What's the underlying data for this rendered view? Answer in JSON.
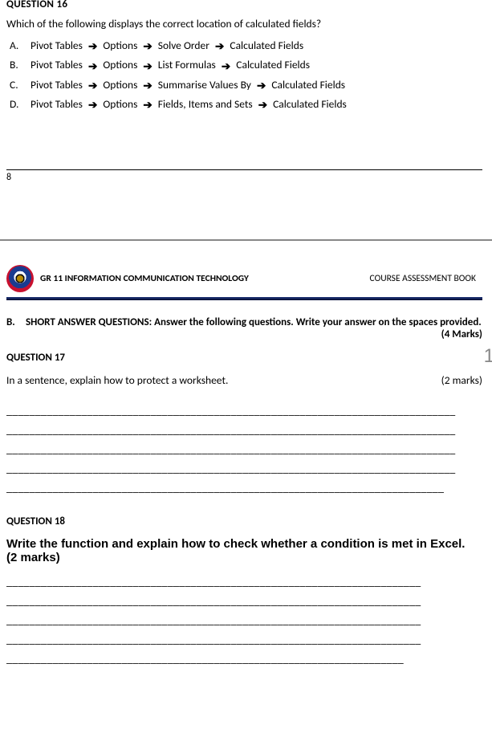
{
  "q16": {
    "heading": "QUESTION 16",
    "prompt": "Which of the following displays the correct location of calculated fields?",
    "optionLabels": {
      "a": "A.",
      "b": "B.",
      "c": "C.",
      "d": "D."
    },
    "options": {
      "a": [
        "Pivot Tables",
        "Options",
        "Solve Order",
        "Calculated Fields"
      ],
      "b": [
        "Pivot Tables",
        "Options",
        "List Formulas",
        "Calculated Fields"
      ],
      "c": [
        "Pivot Tables",
        "Options",
        "Summarise Values By",
        "Calculated Fields"
      ],
      "d": [
        "Pivot Tables",
        "Options",
        "Fields, Items and Sets",
        "Calculated Fields"
      ]
    }
  },
  "footer": {
    "pageNumber": "8"
  },
  "header": {
    "course": "GR 11 INFORMATION COMMUNICATION TECHNOLOGY",
    "bookLabel": "COURSE ASSESSMENT BOOK"
  },
  "sectionB": {
    "label": "B.",
    "text": "SHORT ANSWER QUESTIONS: Answer the following questions. Write your answer on the spaces provided.",
    "marks": "(4 Marks)"
  },
  "q17": {
    "heading": "QUESTION 17",
    "prompt": "In a sentence, explain how to protect a worksheet.",
    "marks": "(2 marks)",
    "sideGlyph": "1",
    "lines": [
      "______________________________________________________________________________",
      "______________________________________________________________________________",
      "______________________________________________________________________________",
      "______________________________________________________________________________",
      "____________________________________________________________________________"
    ]
  },
  "q18": {
    "heading": "QUESTION 18",
    "prompt": "Write the function and explain how to check whether a condition is met in Excel. (2 marks)",
    "lines": [
      "________________________________________________________________________",
      "________________________________________________________________________",
      "________________________________________________________________________",
      "________________________________________________________________________",
      "_____________________________________________________________________"
    ]
  }
}
